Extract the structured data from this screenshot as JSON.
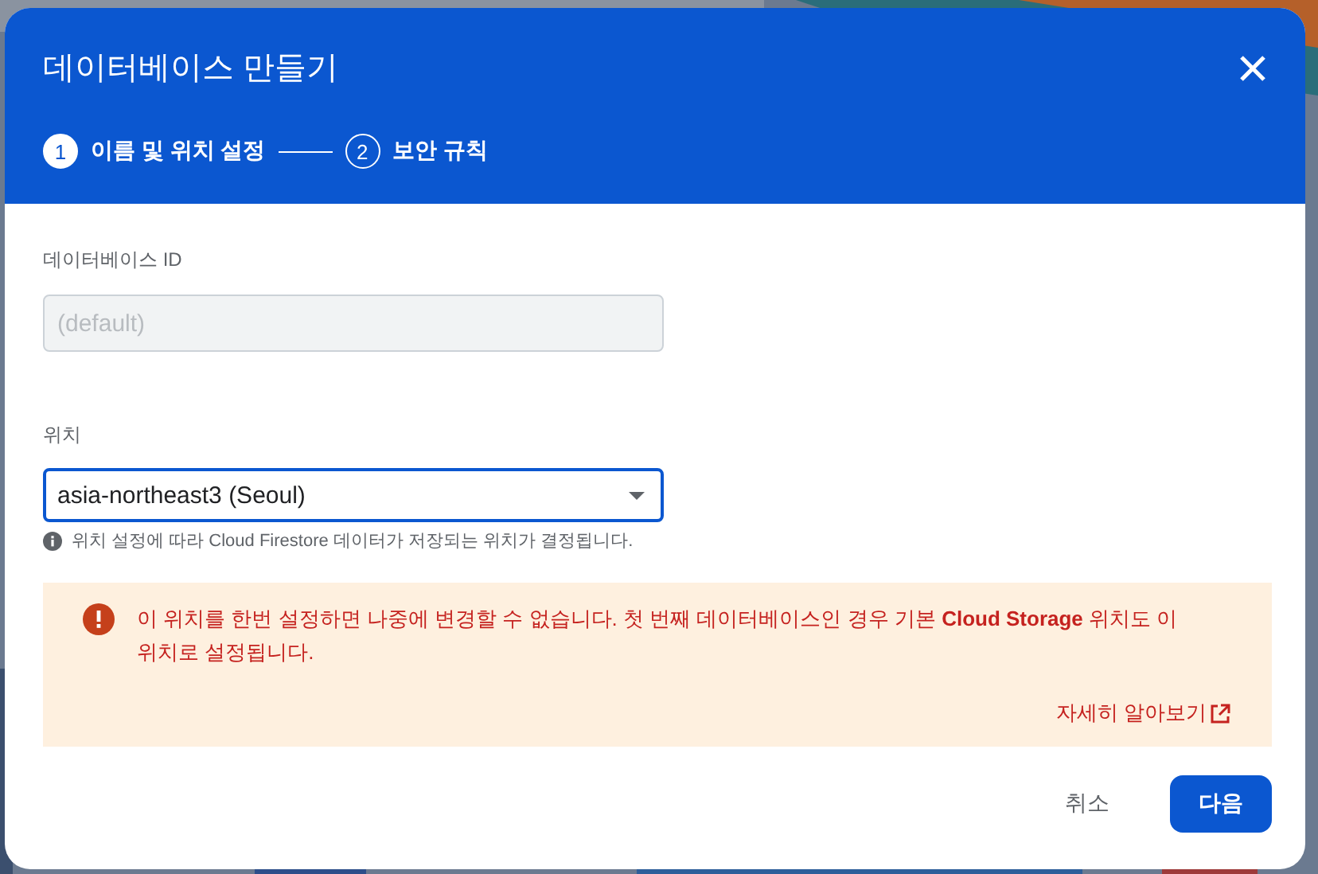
{
  "dialog": {
    "title": "데이터베이스 만들기",
    "steps": [
      {
        "number": "1",
        "label": "이름 및 위치 설정",
        "selected": true
      },
      {
        "number": "2",
        "label": "보안 규칙",
        "selected": false
      }
    ],
    "id_field": {
      "label": "데이터베이스 ID",
      "placeholder": "(default)",
      "disabled": true
    },
    "location_field": {
      "label": "위치",
      "value": "asia-northeast3 (Seoul)",
      "helper": "위치 설정에 따라 Cloud Firestore 데이터가 저장되는 위치가 결정됩니다."
    },
    "warning": {
      "text": "이 위치를 한번 설정하면 나중에 변경할 수 없습니다. 첫 번째 데이터베이스인 경우 기본 **Cloud Storage** 위치도 이 위치로 설정됩니다.",
      "link": "자세히 알아보기"
    },
    "buttons": [
      {
        "label": "취소",
        "kind": "text"
      },
      {
        "label": "다음",
        "kind": "primary"
      }
    ]
  }
}
